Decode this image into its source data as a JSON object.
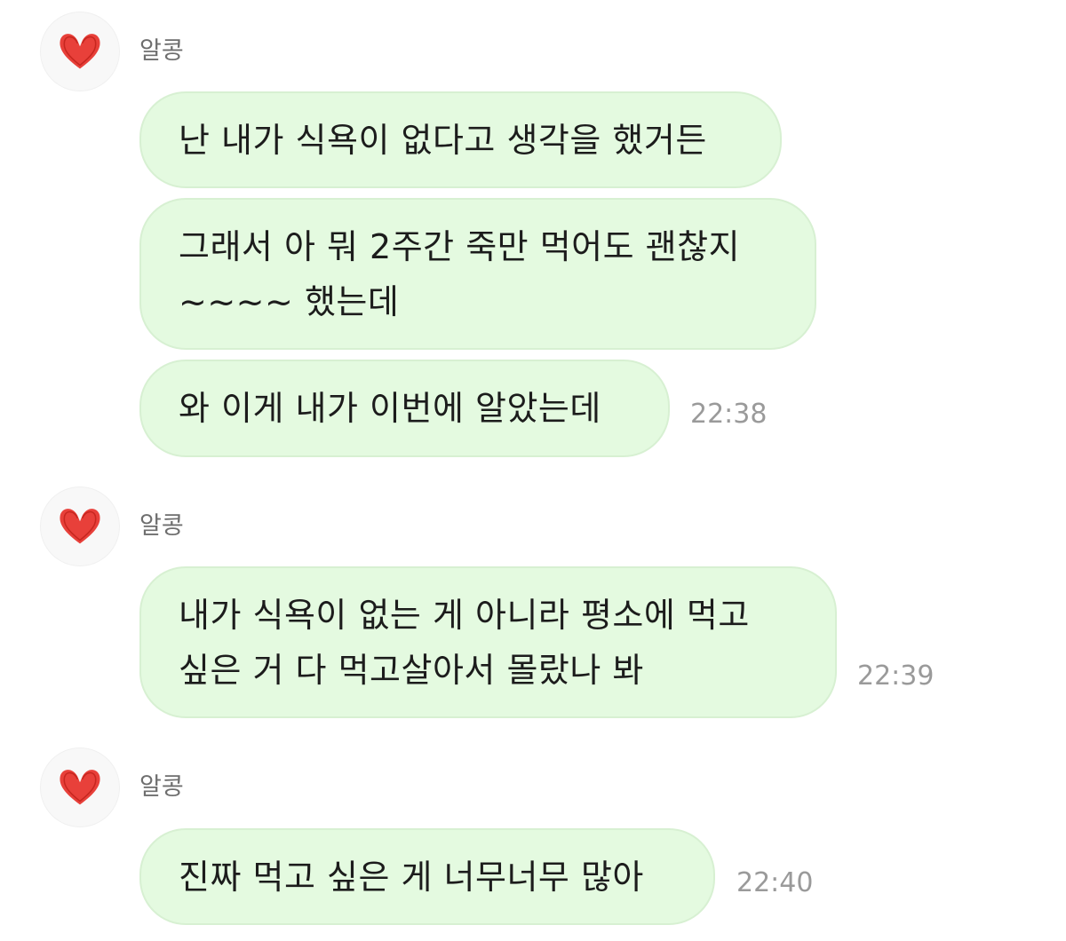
{
  "groups": [
    {
      "sender": "알콩",
      "avatar_icon": "red-heart-icon",
      "messages": [
        {
          "lines": [
            "난 내가 식욕이 없다고 생각을 했거든"
          ]
        },
        {
          "lines": [
            "그래서 아 뭐 2주간 죽만 먹어도 괜찮지",
            "~~~~ 했는데"
          ]
        },
        {
          "lines": [
            "와 이게 내가 이번에 알았는데"
          ],
          "time": "22:38"
        }
      ]
    },
    {
      "sender": "알콩",
      "avatar_icon": "red-heart-icon",
      "messages": [
        {
          "lines": [
            "내가 식욕이 없는 게 아니라 평소에 먹고",
            "싶은 거 다 먹고살아서 몰랐나 봐"
          ],
          "time": "22:39"
        }
      ]
    },
    {
      "sender": "알콩",
      "avatar_icon": "red-heart-icon",
      "messages": [
        {
          "lines": [
            "진짜 먹고 싶은 게 너무너무 많아"
          ],
          "time": "22:40"
        }
      ]
    }
  ],
  "colors": {
    "bubble_background": "#e4fae0",
    "bubble_border": "#d7f0d2",
    "heart": "#e8403a",
    "sender_text": "#6e6e6e",
    "time_text": "#9a9a9a"
  }
}
